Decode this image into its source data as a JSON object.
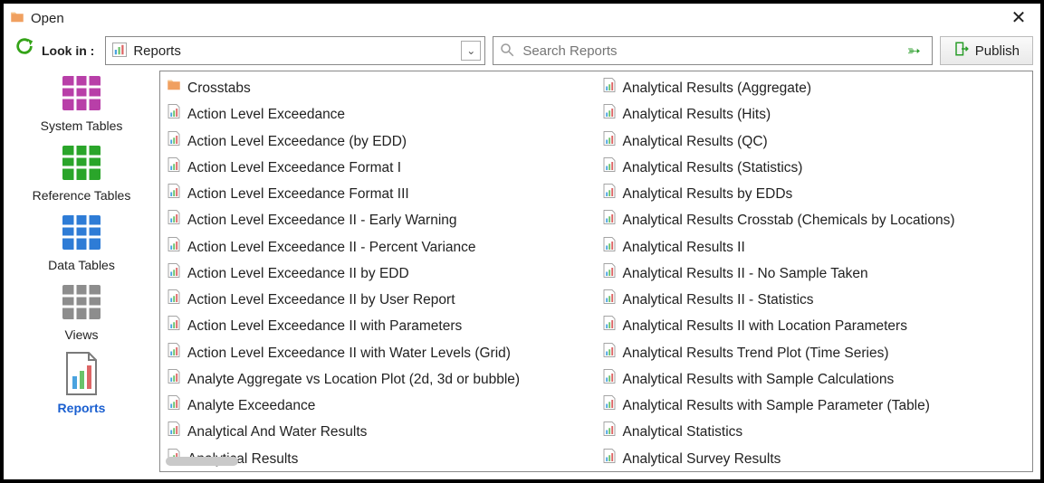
{
  "window": {
    "title": "Open"
  },
  "toolbar": {
    "lookin_label": "Look in :",
    "dropdown_value": "Reports",
    "search_placeholder": "Search Reports",
    "publish_label": "Publish"
  },
  "sidebar": {
    "items": [
      {
        "id": "system-tables",
        "label": "System Tables",
        "color": "#b83fa8"
      },
      {
        "id": "reference-tables",
        "label": "Reference Tables",
        "color": "#2aa52a"
      },
      {
        "id": "data-tables",
        "label": "Data Tables",
        "color": "#2e7cd6"
      },
      {
        "id": "views",
        "label": "Views",
        "color": "#8d8d8d"
      },
      {
        "id": "reports",
        "label": "Reports",
        "color": "#1a5fd0",
        "selected": true
      }
    ]
  },
  "files": {
    "col1": [
      {
        "type": "folder",
        "label": "Crosstabs"
      },
      {
        "type": "report",
        "label": "Action Level Exceedance"
      },
      {
        "type": "report",
        "label": "Action Level Exceedance (by EDD)"
      },
      {
        "type": "report",
        "label": "Action Level Exceedance Format I"
      },
      {
        "type": "report",
        "label": "Action Level Exceedance Format III"
      },
      {
        "type": "report",
        "label": "Action Level Exceedance II - Early Warning"
      },
      {
        "type": "report",
        "label": "Action Level Exceedance II - Percent Variance"
      },
      {
        "type": "report",
        "label": "Action Level Exceedance II by EDD"
      },
      {
        "type": "report",
        "label": "Action Level Exceedance II by User Report"
      },
      {
        "type": "report",
        "label": "Action Level Exceedance II with Parameters"
      },
      {
        "type": "report",
        "label": "Action Level Exceedance II with Water Levels (Grid)"
      },
      {
        "type": "report",
        "label": "Analyte Aggregate vs Location Plot (2d, 3d or bubble)"
      },
      {
        "type": "report",
        "label": "Analyte Exceedance"
      },
      {
        "type": "report",
        "label": "Analytical And Water Results"
      },
      {
        "type": "report",
        "label": "Analytical Results"
      }
    ],
    "col2": [
      {
        "type": "report",
        "label": "Analytical Results (Aggregate)"
      },
      {
        "type": "report",
        "label": "Analytical Results (Hits)"
      },
      {
        "type": "report",
        "label": "Analytical Results (QC)"
      },
      {
        "type": "report",
        "label": "Analytical Results (Statistics)"
      },
      {
        "type": "report",
        "label": "Analytical Results by EDDs"
      },
      {
        "type": "report",
        "label": "Analytical Results Crosstab (Chemicals by Locations)"
      },
      {
        "type": "report",
        "label": "Analytical Results II"
      },
      {
        "type": "report",
        "label": "Analytical Results II - No Sample Taken"
      },
      {
        "type": "report",
        "label": "Analytical Results II - Statistics"
      },
      {
        "type": "report",
        "label": "Analytical Results II with Location Parameters"
      },
      {
        "type": "report",
        "label": "Analytical Results Trend Plot (Time Series)"
      },
      {
        "type": "report",
        "label": "Analytical Results with Sample Calculations"
      },
      {
        "type": "report",
        "label": "Analytical Results with Sample Parameter (Table)"
      },
      {
        "type": "report",
        "label": "Analytical Statistics"
      },
      {
        "type": "report",
        "label": "Analytical Survey Results"
      }
    ]
  }
}
